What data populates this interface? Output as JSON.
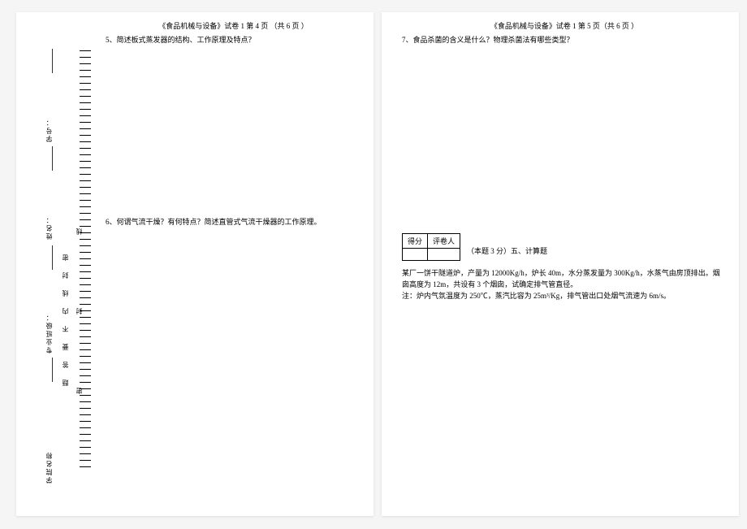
{
  "binding": {
    "xueyuan": "学院名称",
    "zhuanye": "专业班级：",
    "xingming": "姓名：",
    "xuehao": "学号：",
    "seal_line": "题答要不内线封密",
    "seal_chars": "密封线"
  },
  "left_page": {
    "header": "《食品机械与设备》试卷 1 第 4 页 （共 6 页 ）",
    "q5": "5、简述板式蒸发器的结构、工作原理及特点？",
    "q6": "6、何谓气流干燥？有何特点？简述直管式气流干燥器的工作原理。"
  },
  "right_page": {
    "header": "《食品机械与设备》试卷 1 第 5 页（共 6 页 ）",
    "q7": "7、食品杀菌的含义是什么？物理杀菌法有哪些类型？",
    "score_col1": "得分",
    "score_col2": "评卷人",
    "section_title": "（本题 3 分）五、计算题",
    "problem_line1": "某厂一饼干隧道炉，产量为 12000Kg/h，炉长 40m，水分蒸发量为 300Kg/h，水蒸气由房顶排出。烟囱高度为 12m，共设有 3 个烟囱，试确定排气管直径。",
    "problem_line2": "注：炉内气氛温度为 250℃，蒸汽比容为 25m³/Kg，排气管出口处烟气流速为 6m/s。"
  }
}
